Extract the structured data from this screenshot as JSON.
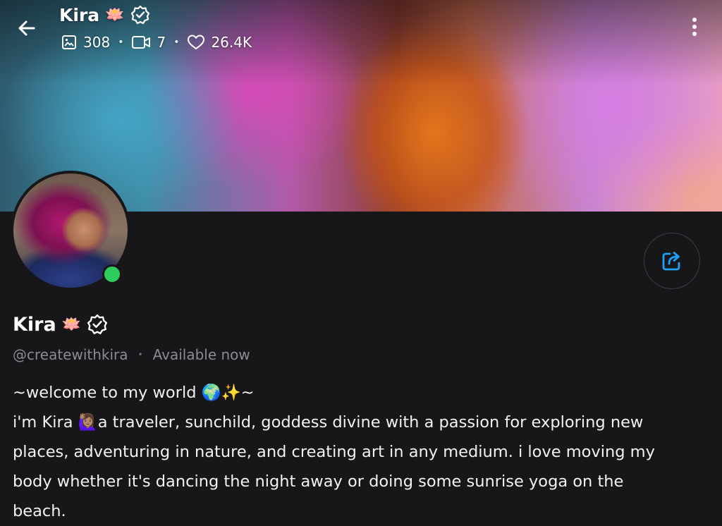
{
  "header": {
    "name": "Kira",
    "name_emoji": "🪷",
    "stats": {
      "photos": "308",
      "videos": "7",
      "likes": "26.4K"
    }
  },
  "profile": {
    "name": "Kira",
    "name_emoji": "🪷",
    "handle": "@createwithkira",
    "status": "Available now",
    "online": true
  },
  "bio": {
    "lines": [
      "~welcome to my world 🌍✨~",
      "i'm Kira 🙋🏽‍♀️a traveler, sunchild, goddess divine with a passion for exploring new",
      "places, adventuring in nature, and creating art in any medium. i love moving my",
      "body whether it's dancing the night away or doing some sunrise yoga on the",
      "beach."
    ]
  },
  "icons": {
    "back": "back-arrow-icon",
    "verified": "verified-badge-icon",
    "photos": "image-icon",
    "videos": "video-icon",
    "likes": "heart-icon",
    "more": "more-vertical-icon",
    "share": "share-icon"
  },
  "colors": {
    "background": "#17171a",
    "accent": "#1da1f2",
    "online": "#2ecc5a",
    "muted_text": "#8a8a93"
  }
}
